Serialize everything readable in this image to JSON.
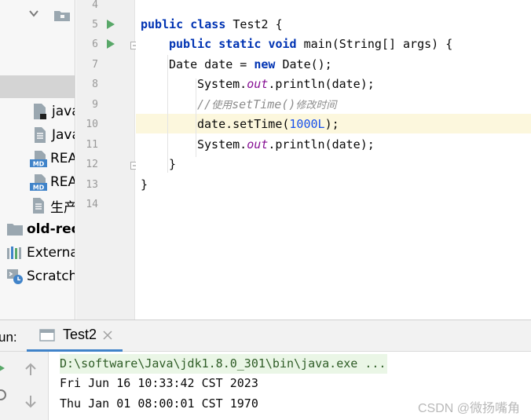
{
  "colors": {
    "keyword": "#0033b3",
    "static_field": "#871094",
    "number": "#1750eb",
    "comment": "#8c8c8c",
    "current_line": "#fcf7dd",
    "run_arrow": "#59a869",
    "tab_underline": "#4083c9"
  },
  "sidebar": {
    "items": [
      {
        "label": "java",
        "icon": "java-file-icon",
        "bold": false
      },
      {
        "label": "Java",
        "icon": "text-file-icon",
        "bold": false
      },
      {
        "label": "REA",
        "icon": "markdown-icon",
        "bold": false
      },
      {
        "label": "REA",
        "icon": "markdown-icon",
        "bold": false
      },
      {
        "label": "生产",
        "icon": "text-file-icon",
        "bold": false
      },
      {
        "label": "old-rec",
        "icon": "folder-icon",
        "bold": true
      },
      {
        "label": "Externa",
        "icon": "external-libraries-icon",
        "bold": false
      },
      {
        "label": "Scratch",
        "icon": "scratches-icon",
        "bold": false
      }
    ]
  },
  "editor": {
    "line_numbers": [
      "4",
      "5",
      "6",
      "7",
      "8",
      "9",
      "10",
      "11",
      "12",
      "13",
      "14"
    ],
    "current_line": "10",
    "lines": {
      "l5": {
        "kw1": "public",
        "kw2": "class",
        "rest": "Test2 {"
      },
      "l6": {
        "kw1": "public",
        "kw2": "static",
        "kw3": "void",
        "rest": "main(String[] args) {"
      },
      "l7": {
        "pre": "Date date = ",
        "kw": "new",
        "post": "Date();"
      },
      "l8": {
        "pre": "System.",
        "fld": "out",
        "post": ".println(date);"
      },
      "l9": {
        "slashes": "//",
        "zh1": "使用",
        "mid": "setTime()",
        "zh2": "修改时间"
      },
      "l10": {
        "pre": "date.setTime(",
        "num": "1000L",
        "post": ");"
      },
      "l11": {
        "pre": "System.",
        "fld": "out",
        "post": ".println(date);"
      },
      "l12": {
        "text": "}"
      },
      "l13": {
        "text": "}"
      }
    }
  },
  "run": {
    "title": "un:",
    "tab_label": "Test2",
    "console": [
      "D:\\software\\Java\\jdk1.8.0_301\\bin\\java.exe ...",
      "Fri Jun 16 10:33:42 CST 2023",
      "Thu Jan 01 08:00:01 CST 1970"
    ]
  },
  "watermark": "CSDN @微扬嘴角"
}
